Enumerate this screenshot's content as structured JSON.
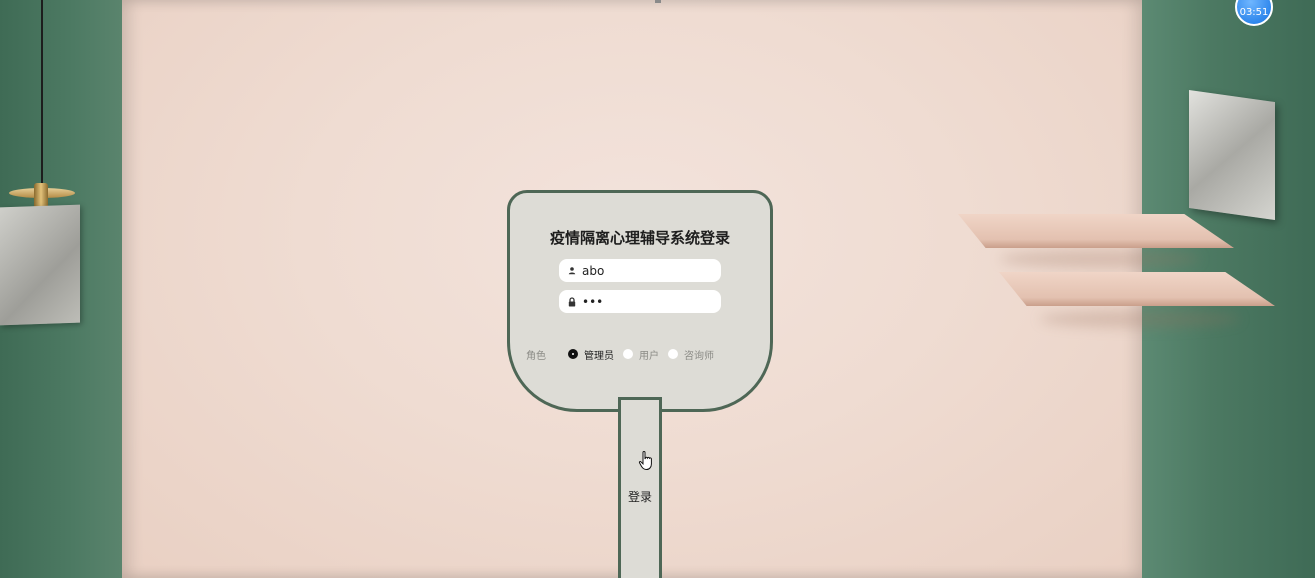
{
  "timer": {
    "text": "03:51"
  },
  "login": {
    "title": "疫情隔离心理辅导系统登录",
    "username": {
      "value": "abo",
      "icon": "user-icon"
    },
    "password": {
      "value": "•••",
      "icon": "lock-icon"
    },
    "role_label": "角色",
    "roles": [
      {
        "label": "管理员",
        "selected": true
      },
      {
        "label": "用户",
        "selected": false
      },
      {
        "label": "咨询师",
        "selected": false
      }
    ],
    "submit_label": "登录"
  },
  "colors": {
    "wall_green": "#4a7660",
    "wall_peach": "#efdcd2",
    "card_bg": "#dddcd6",
    "card_border": "#4e6756",
    "timer_blue": "#2f87ec"
  }
}
